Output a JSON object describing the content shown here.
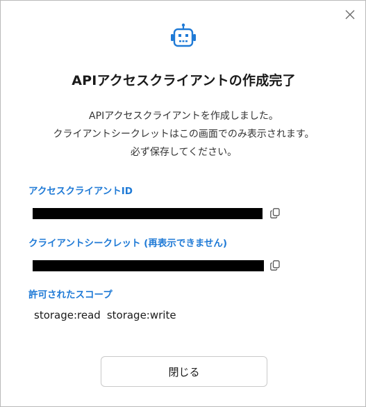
{
  "dialog": {
    "title": "APIアクセスクライアントの作成完了",
    "message_lines": [
      "APIアクセスクライアントを作成しました。",
      "クライアントシークレットはこの画面でのみ表示されます。",
      "必ず保存してください。"
    ],
    "client_id_label": "アクセスクライアントID",
    "client_secret_label": "クライアントシークレット (再表示できません)",
    "scopes_label": "許可されたスコープ",
    "scopes": [
      "storage:read",
      "storage:write"
    ],
    "close_button_label": "閉じる"
  },
  "icons": {
    "close": "close-icon",
    "bot": "robot-icon",
    "copy": "copy-icon"
  },
  "colors": {
    "accent": "#1f7ad6",
    "mask": "#000000",
    "border": "#b9b9b9"
  }
}
